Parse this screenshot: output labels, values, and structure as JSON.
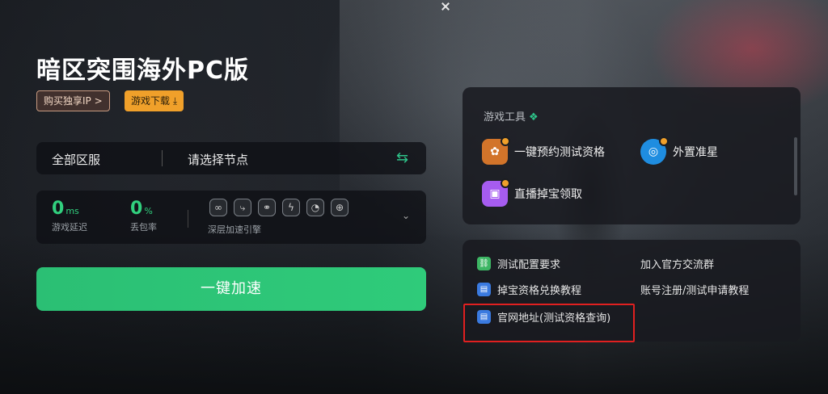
{
  "app": {
    "title": "暗区突围海外PC版"
  },
  "actions": {
    "buy_ip_label": "购买独享IP >",
    "download_label": "游戏下载 ⤓",
    "accelerate_label": "一键加速"
  },
  "server": {
    "region_label": "全部区服",
    "node_placeholder": "请选择节点",
    "swap_icon": "swap-icon"
  },
  "stats": {
    "delay": {
      "value": "0",
      "unit": "ms",
      "label": "游戏延迟"
    },
    "loss": {
      "value": "0",
      "unit": "%",
      "label": "丢包率"
    },
    "engine_label": "深层加速引擎",
    "engine_icons": [
      "link-icon",
      "route-icon",
      "multi-link-icon",
      "lightning-icon",
      "speed-gauge-icon",
      "download-circle-icon"
    ]
  },
  "tools_panel": {
    "header": "游戏工具",
    "items": [
      {
        "label": "一键预约测试资格",
        "icon": "calendar-reserve-icon"
      },
      {
        "label": "外置准星",
        "icon": "crosshair-icon"
      },
      {
        "label": "直播掉宝领取",
        "icon": "live-stream-icon"
      }
    ]
  },
  "links_panel": {
    "items": [
      {
        "label": "测试配置要求",
        "icon": "link-icon"
      },
      {
        "label": "掉宝资格兑换教程",
        "icon": "tutorial-icon"
      },
      {
        "label": "官网地址(测试资格查询)",
        "icon": "website-icon"
      },
      {
        "label": "加入官方交流群",
        "icon": ""
      },
      {
        "label": "账号注册/测试申请教程",
        "icon": ""
      }
    ]
  },
  "colors": {
    "accent_green": "#2fcb7a",
    "download_orange": "#f0a02a",
    "highlight_red": "#e02020"
  }
}
